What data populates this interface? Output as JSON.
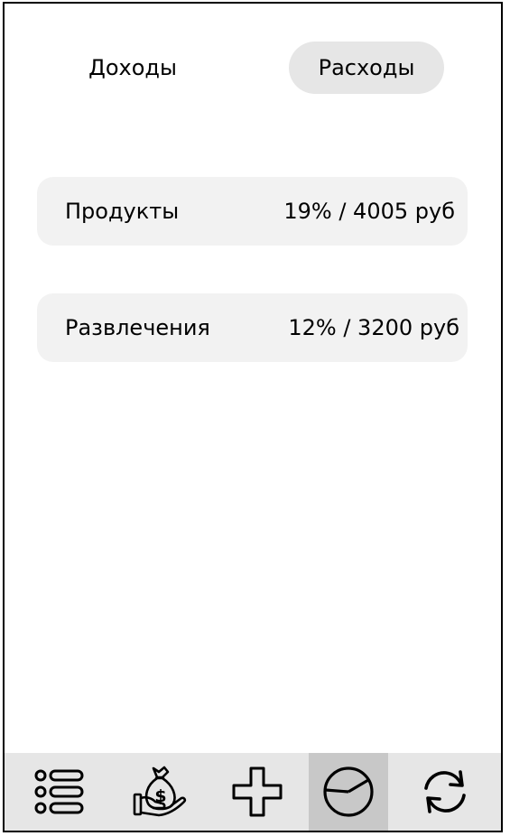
{
  "tabs": {
    "income_label": "Доходы",
    "expenses_label": "Расходы",
    "selected": "expenses"
  },
  "categories": [
    {
      "label": "Продукты",
      "value": "19% / 4005 руб"
    },
    {
      "label": "Развлечения",
      "value": "12% / 3200 руб"
    }
  ],
  "navbar": {
    "items": [
      {
        "icon": "list-icon"
      },
      {
        "icon": "money-bag-hand-icon"
      },
      {
        "icon": "plus-icon"
      },
      {
        "icon": "pie-chart-icon",
        "active": true
      },
      {
        "icon": "refresh-icon"
      }
    ]
  }
}
